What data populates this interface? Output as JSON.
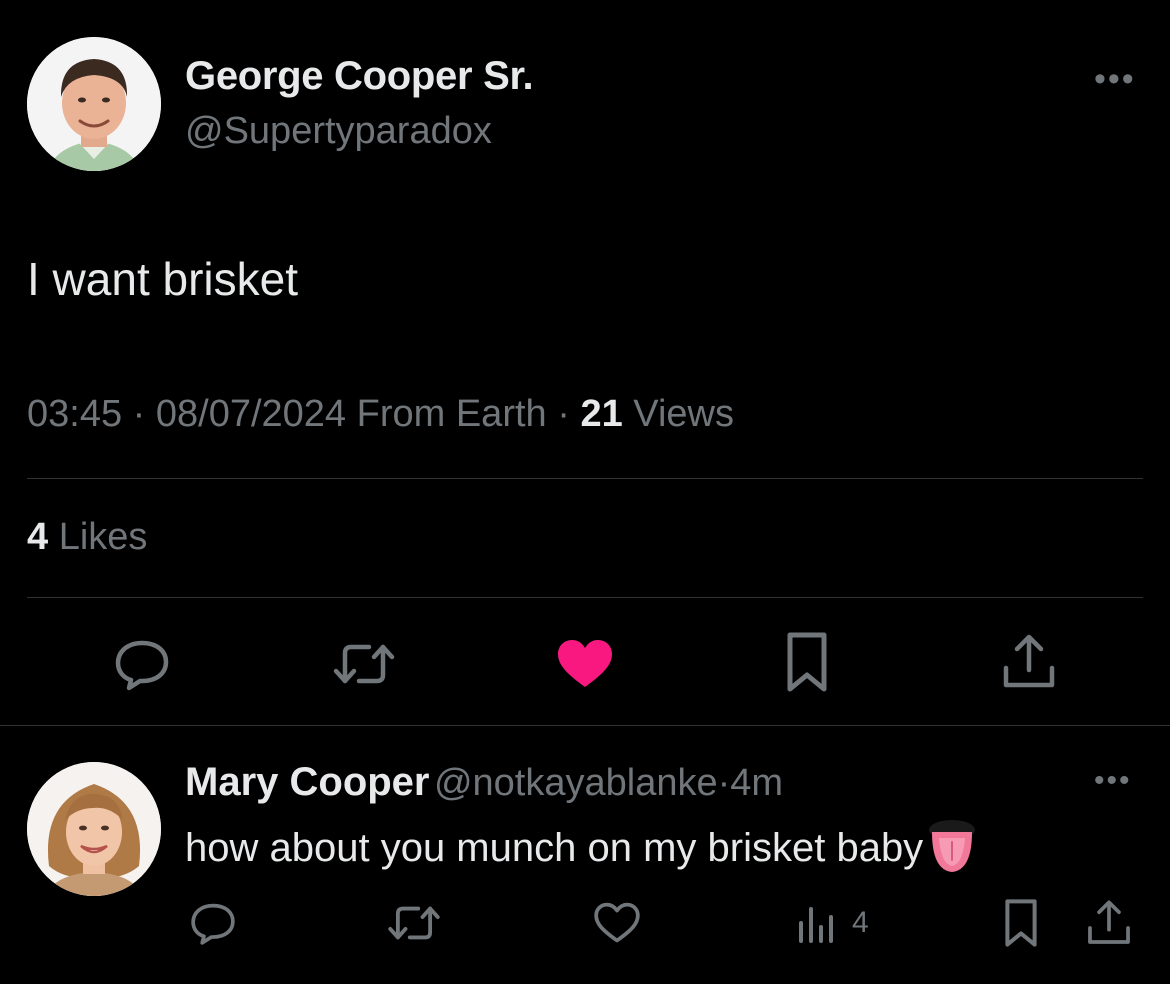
{
  "tweet": {
    "author_name": "George Cooper Sr.",
    "author_handle": "@Supertyparadox",
    "more_label": "•••",
    "text": "I want brisket",
    "time": "03:45",
    "date": "08/07/2024",
    "source": "From Earth",
    "separator": "·",
    "views_count": "21",
    "views_label": "Views",
    "likes_count": "4",
    "likes_label": "Likes",
    "liked": true
  },
  "reply": {
    "author_name": "Mary Cooper",
    "author_handle": "@notkayablanke",
    "separator": "·",
    "age": "4m",
    "text": "how about you munch on my brisket baby",
    "emoji": "tongue",
    "views_count": "4",
    "more_label": "•••"
  },
  "colors": {
    "background": "#000000",
    "primary_text": "#e7e9ea",
    "secondary_text": "#71767b",
    "divider": "#2f3336",
    "like_active": "#f91880"
  }
}
